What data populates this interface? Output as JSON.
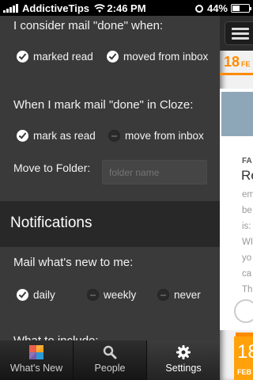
{
  "status_bar": {
    "carrier": "AddictiveTips",
    "time": "2:46 PM",
    "battery": "44%",
    "battery_level": 0.44
  },
  "settings": {
    "done_heading": "I consider mail \"done\" when:",
    "done_options": [
      {
        "label": "marked read",
        "checked": true
      },
      {
        "label": "moved from inbox",
        "checked": true
      }
    ],
    "when_done_heading": "When I mark mail \"done\" in Cloze:",
    "when_done_options": [
      {
        "label": "mark as read",
        "checked": true
      },
      {
        "label": "move from inbox",
        "checked": false
      }
    ],
    "move_folder_label": "Move to Folder:",
    "folder_placeholder": "folder name",
    "notifications_title": "Notifications",
    "mail_new_heading": "Mail what's new to me:",
    "frequency_options": [
      {
        "label": "daily",
        "checked": true
      },
      {
        "label": "weekly",
        "checked": false
      },
      {
        "label": "never",
        "checked": false
      }
    ],
    "next_heading_partial": "What to include:"
  },
  "tab_bar": {
    "tabs": [
      {
        "label": "What's New",
        "icon": "cloze-logo-icon",
        "active": false
      },
      {
        "label": "People",
        "icon": "search-icon",
        "active": false
      },
      {
        "label": "Settings",
        "icon": "gear-icon",
        "active": true
      }
    ]
  },
  "peek": {
    "date_number": "18",
    "date_suffix": "FE",
    "card_sender": "FA",
    "card_title": "Re",
    "card_text": "em\nbe\nis:\nWI\nyo\nca\nTh",
    "bottom_number": "18",
    "bottom_label": "FEB",
    "accent_color": "#ff8a00"
  }
}
